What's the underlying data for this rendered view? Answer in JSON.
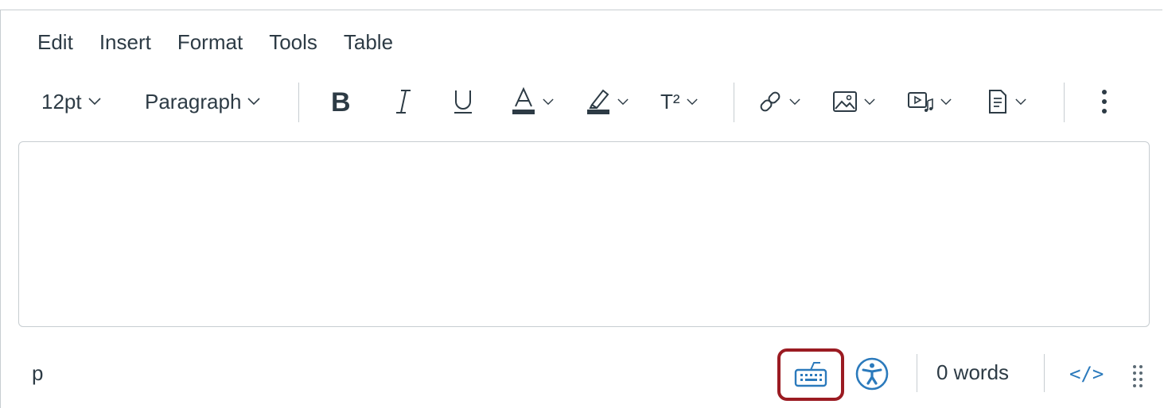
{
  "menubar": {
    "items": [
      "Edit",
      "Insert",
      "Format",
      "Tools",
      "Table"
    ]
  },
  "toolbar": {
    "font_size": "12pt",
    "block_format": "Paragraph",
    "superscript_label": "T²"
  },
  "statusbar": {
    "path": "p",
    "word_count": "0 words",
    "html_toggle": "</>"
  },
  "colors": {
    "text": "#2d3b45",
    "accent": "#2b7abc",
    "highlight_outline": "#9b1b22",
    "border": "#c7cdd1"
  },
  "icons": [
    "bold-icon",
    "italic-icon",
    "underline-icon",
    "text-color-icon",
    "highlight-color-icon",
    "superscript-icon",
    "link-icon",
    "image-icon",
    "media-icon",
    "document-icon",
    "more-options-icon",
    "keyboard-icon",
    "accessibility-icon",
    "resize-grip-icon"
  ]
}
